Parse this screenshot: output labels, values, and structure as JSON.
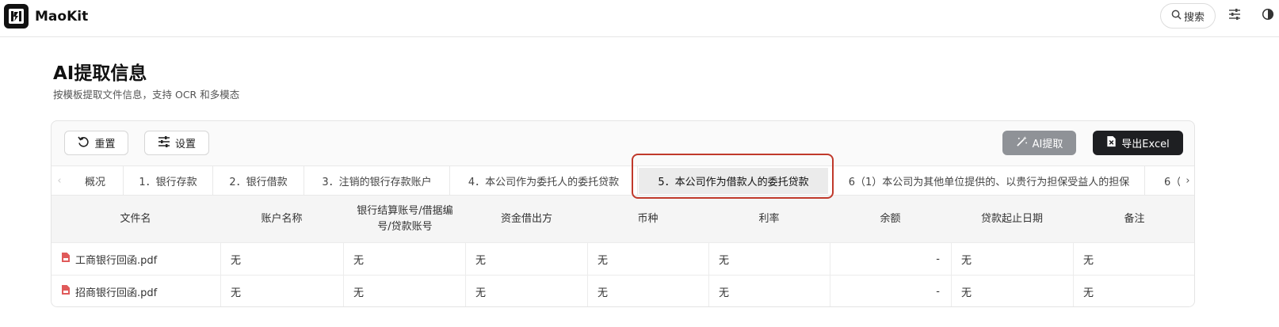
{
  "app": {
    "name": "MaoKit"
  },
  "header": {
    "search_label": "搜索"
  },
  "page": {
    "title": "AI提取信息",
    "subtitle": "按模板提取文件信息，支持 OCR 和多模态"
  },
  "toolbar": {
    "reset_label": "重置",
    "settings_label": "设置",
    "ai_extract_label": "AI提取",
    "export_label": "导出Excel"
  },
  "tabs": [
    {
      "label": "概况"
    },
    {
      "label": "1．银行存款"
    },
    {
      "label": "2．银行借款"
    },
    {
      "label": "3．注销的银行存款账户"
    },
    {
      "label": "4．本公司作为委托人的委托贷款"
    },
    {
      "label": "5．本公司作为借款人的委托贷款"
    },
    {
      "label": "6（1）本公司为其他单位提供的、以贵行为担保受益人的担保"
    },
    {
      "label": "6（"
    }
  ],
  "active_tab_index": 5,
  "table": {
    "columns": [
      "文件名",
      "账户名称",
      "银行结算账号/借据编号/贷款账号",
      "资金借出方",
      "币种",
      "利率",
      "余额",
      "贷款起止日期",
      "备注"
    ],
    "rows": [
      {
        "file": "工商银行回函.pdf",
        "cells": [
          "无",
          "无",
          "无",
          "无",
          "无",
          "-",
          "无",
          "无"
        ]
      },
      {
        "file": "招商银行回函.pdf",
        "cells": [
          "无",
          "无",
          "无",
          "无",
          "无",
          "-",
          "无",
          "无"
        ]
      }
    ]
  },
  "colors": {
    "accent_dark": "#1e1f22",
    "ai_button": "#8f9297",
    "highlight": "#c0392b",
    "pdf_icon": "#e05a5a"
  }
}
